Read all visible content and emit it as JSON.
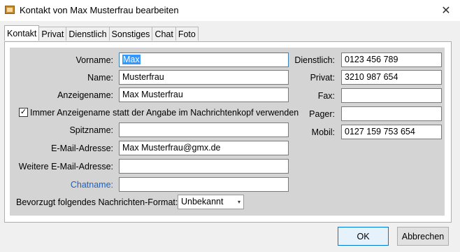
{
  "window": {
    "title": "Kontakt von Max Musterfrau bearbeiten",
    "close_glyph": "✕"
  },
  "tabs": [
    {
      "label": "Kontakt",
      "active": true
    },
    {
      "label": "Privat"
    },
    {
      "label": "Dienstlich"
    },
    {
      "label": "Sonstiges"
    },
    {
      "label": "Chat"
    },
    {
      "label": "Foto"
    }
  ],
  "form": {
    "vorname_label": "Vorname:",
    "vorname_value": "Max",
    "name_label": "Name:",
    "name_value": "Musterfrau",
    "anzeigename_label": "Anzeigename:",
    "anzeigename_value": "Max Musterfrau",
    "checkbox_label": "Immer Anzeigename statt der Angabe im Nachrichtenkopf verwenden",
    "checkbox_checked": true,
    "checkbox_glyph": "✓",
    "spitzname_label": "Spitzname:",
    "spitzname_value": "",
    "email_label": "E-Mail-Adresse:",
    "email_value": "Max Musterfrau@gmx.de",
    "weitere_email_label": "Weitere E-Mail-Adresse:",
    "weitere_email_value": "",
    "chatname_label": "Chatname:",
    "chatname_value": "",
    "format_label": "Bevorzugt folgendes Nachrichten-Format:",
    "format_value": "Unbekannt",
    "format_arrow": "▾"
  },
  "phones": {
    "dienstlich_label": "Dienstlich:",
    "dienstlich_value": "0123 456 789",
    "privat_label": "Privat:",
    "privat_value": "3210 987 654",
    "fax_label": "Fax:",
    "fax_value": "",
    "pager_label": "Pager:",
    "pager_value": "",
    "mobil_label": "Mobil:",
    "mobil_value": "0127 159 753 654"
  },
  "buttons": {
    "ok": "OK",
    "cancel": "Abbrechen"
  },
  "colors": {
    "link_blue": "#1f5fbf",
    "selection": "#3399ff",
    "default_button_border": "#0078d7"
  }
}
